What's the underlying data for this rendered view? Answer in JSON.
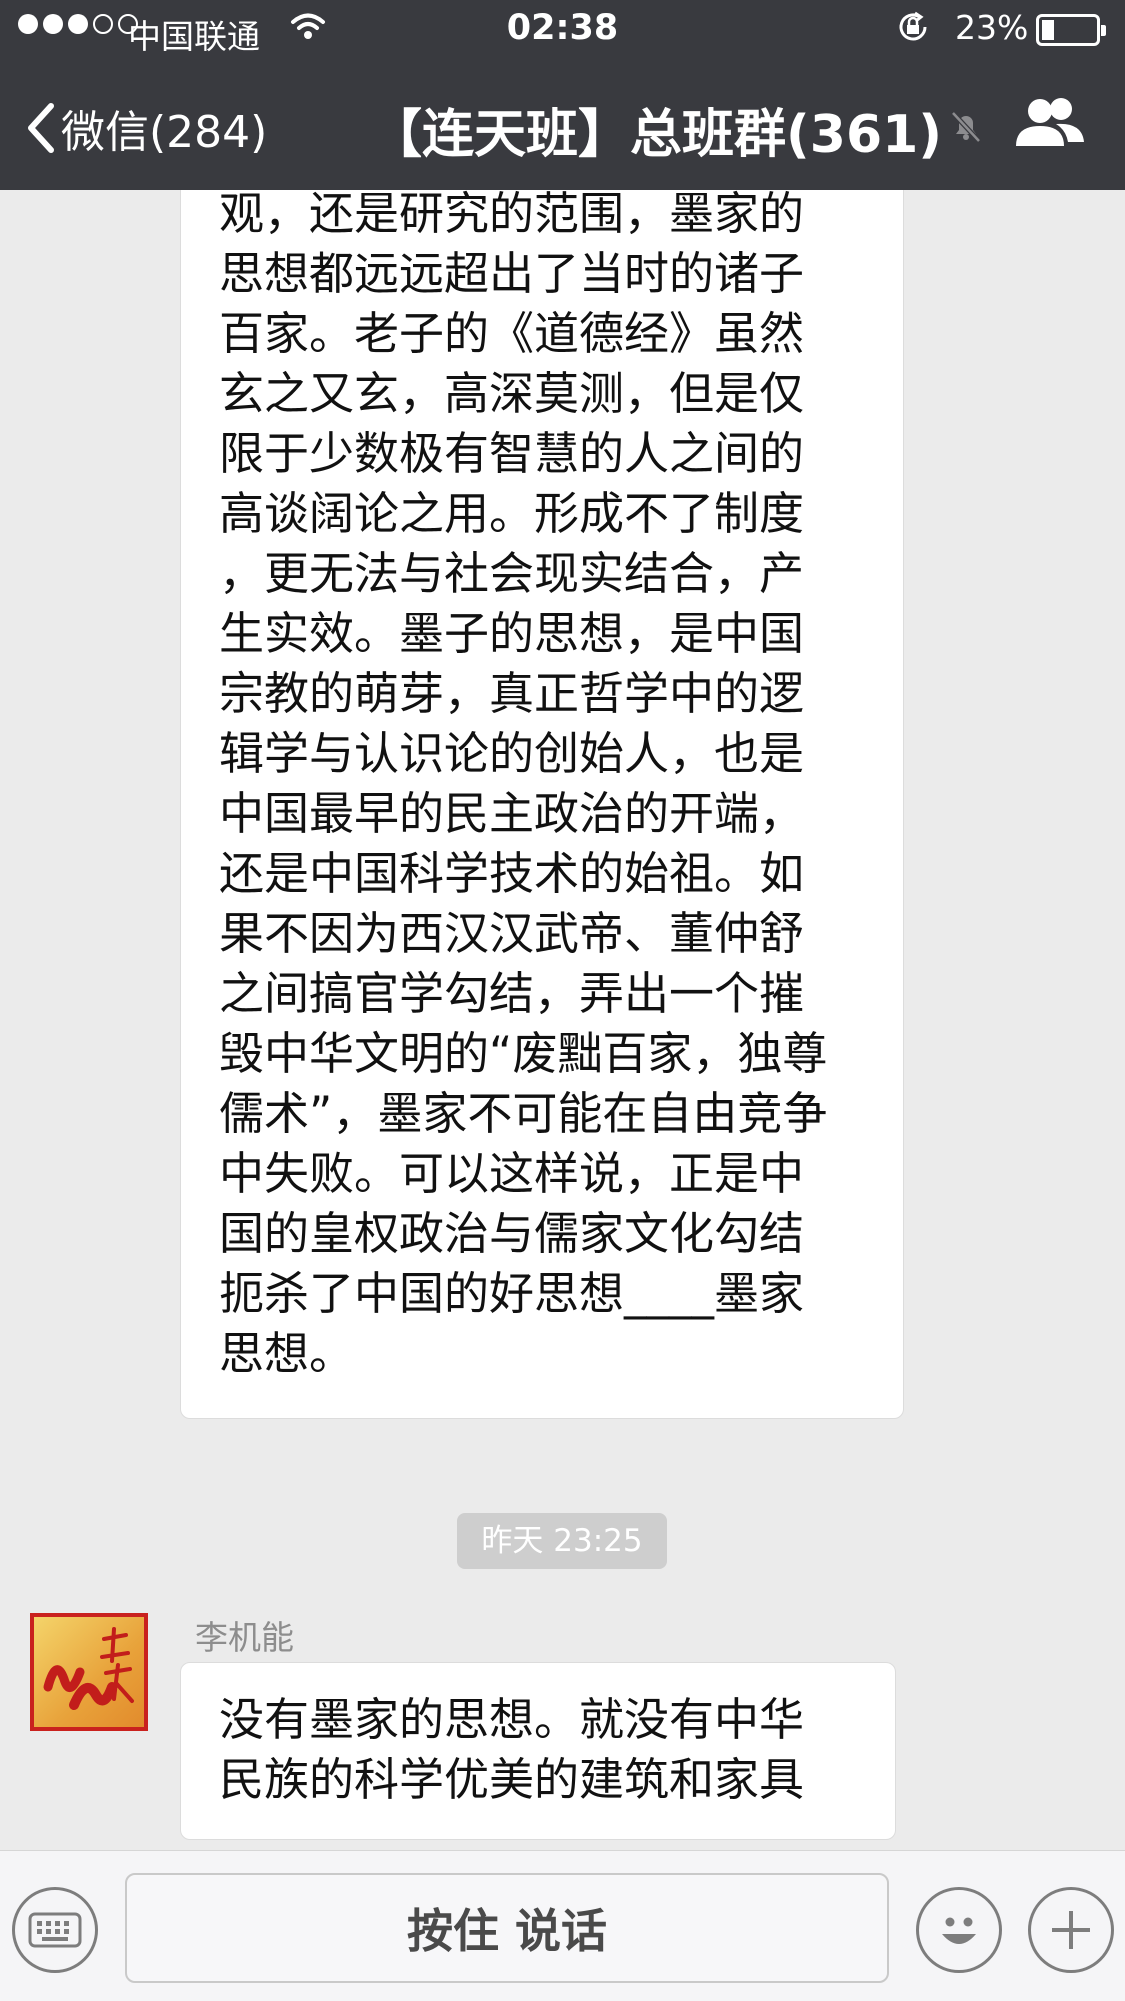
{
  "status_bar": {
    "carrier": "中国联通",
    "time": "02:38",
    "battery_percent": "23%",
    "battery_level": 0.23,
    "signal_bars_filled": 3,
    "signal_bars_total": 5
  },
  "nav": {
    "back_label": "微信(284)",
    "title": "【连天班】总班群(361)"
  },
  "messages": [
    {
      "lines": [
        "观，还是研究的范围，墨家的",
        "思想都远远超出了当时的诸子",
        "百家。老子的《道德经》虽然",
        "玄之又玄，高深莫测，但是仅",
        "限于少数极有智慧的人之间的",
        "高谈阔论之用。形成不了制度",
        "，更无法与社会现实结合，产",
        "生实效。墨子的思想，是中国",
        "宗教的萌芽，真正哲学中的逻",
        "辑学与认识论的创始人，也是",
        "中国最早的民主政治的开端，",
        "还是中国科学技术的始祖。如",
        "果不因为西汉汉武帝、董仲舒",
        "之间搞官学勾结，弄出一个摧",
        "毁中华文明的“废黜百家，独尊",
        "儒术”，墨家不可能在自由竞争",
        "中失败。可以这样说，正是中",
        "国的皇权政治与儒家文化勾结",
        "扼杀了中国的好思想____墨家",
        "思想。"
      ]
    },
    {
      "timestamp": "昨天 23:25",
      "sender": "李机能",
      "lines": [
        "没有墨家的思想。就没有中华",
        "民族的科学优美的建筑和家具"
      ]
    }
  ],
  "input_bar": {
    "hold_to_talk_label": "按住 说话"
  },
  "colors": {
    "nav_bg": "#393a3f",
    "chat_bg": "#ebebeb",
    "bubble_bg": "#ffffff",
    "timestamp_bg": "#cecece"
  },
  "icons": {
    "back": "chevron-left-icon",
    "wifi": "wifi-icon",
    "lock": "rotation-lock-icon",
    "mute": "bell-slash-icon",
    "members": "group-members-icon",
    "keyboard": "keyboard-icon",
    "emoji": "smiley-icon",
    "plus": "plus-icon"
  }
}
